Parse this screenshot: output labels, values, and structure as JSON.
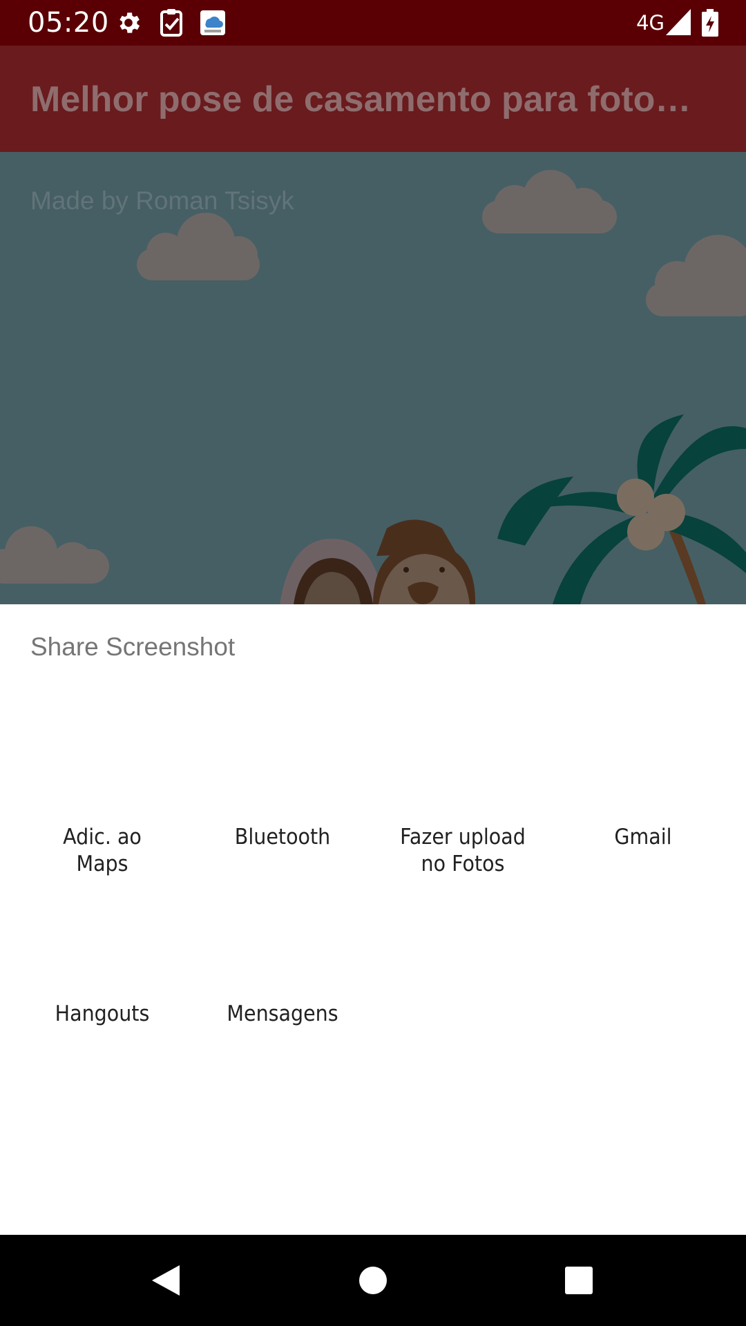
{
  "status_bar": {
    "time": "05:20",
    "network": "4G",
    "icons": [
      "settings-icon",
      "task-check-icon",
      "cloud-app-icon",
      "signal-icon",
      "battery-charging-icon"
    ]
  },
  "app_bar": {
    "title": "Melhor pose de casamento para foto…"
  },
  "content": {
    "made_by": "Made by Roman Tsisyk"
  },
  "share_sheet": {
    "title": "Share Screenshot",
    "targets": [
      {
        "label": "Adic. ao\nMaps"
      },
      {
        "label": "Bluetooth"
      },
      {
        "label": "Fazer upload\nno Fotos"
      },
      {
        "label": "Gmail"
      },
      {
        "label": "Hangouts"
      },
      {
        "label": "Mensagens"
      }
    ]
  },
  "nav_bar": {
    "buttons": [
      "back-icon",
      "home-icon",
      "recents-icon"
    ]
  },
  "colors": {
    "status_bar": "#5a0005",
    "app_bar": "#6a1b1e",
    "scene_background": "#465f64",
    "sheet_background": "#ffffff"
  }
}
